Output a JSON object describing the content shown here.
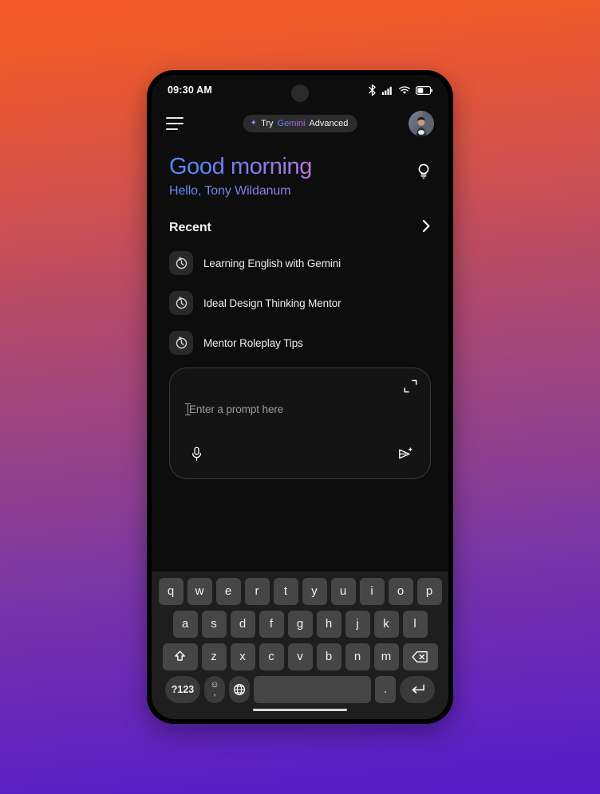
{
  "statusbar": {
    "time": "09:30 AM",
    "icons": [
      "bluetooth-icon",
      "cellular-signal-icon",
      "wifi-icon",
      "battery-icon"
    ]
  },
  "appbar": {
    "menu_icon": "hamburger-menu-icon",
    "promo_pill": {
      "sparkle": "✦",
      "try_label": "Try",
      "brand_label": "Gemini",
      "advanced_label": "Advanced"
    },
    "avatar": "user-avatar"
  },
  "main": {
    "greeting": "Good morning",
    "subgreeting": "Hello, Tony Wildanum",
    "bulb_icon": "lightbulb-icon",
    "recent": {
      "label": "Recent",
      "chevron_icon": "chevron-right-icon"
    },
    "history": [
      {
        "icon": "history-clock-icon",
        "label": "Learning English with Gemini"
      },
      {
        "icon": "history-clock-icon",
        "label": "Ideal Design Thinking Mentor"
      },
      {
        "icon": "history-clock-icon",
        "label": "Mentor Roleplay Tips"
      }
    ],
    "prompt": {
      "placeholder": "Enter a prompt here",
      "value": "",
      "expand_icon": "expand-icon",
      "mic_icon": "microphone-icon",
      "send_icon": "send-sparkle-icon"
    }
  },
  "keyboard": {
    "row1": [
      "q",
      "w",
      "e",
      "r",
      "t",
      "y",
      "u",
      "i",
      "o",
      "p"
    ],
    "row2": [
      "a",
      "s",
      "d",
      "f",
      "g",
      "h",
      "j",
      "k",
      "l"
    ],
    "row3_keys": [
      "z",
      "x",
      "c",
      "v",
      "b",
      "n",
      "m"
    ],
    "shift_icon": "shift-up-arrow-icon",
    "backspace_icon": "backspace-delete-icon",
    "numeric_label": "?123",
    "emoji_face": "☺",
    "emoji_comma": ",",
    "globe_icon": "language-globe-icon",
    "space_label": "",
    "period_label": ".",
    "enter_icon": "enter-return-icon"
  },
  "system": {
    "home_indicator": "home-gesture-bar"
  },
  "colors": {
    "background_top": "#F05A2A",
    "background_bottom": "#5A1CC6",
    "screen_bg": "#0D0D0D",
    "keyboard_bg": "#1E1E1E",
    "key_bg": "#464646",
    "accent_purple": "#B07CF5"
  }
}
